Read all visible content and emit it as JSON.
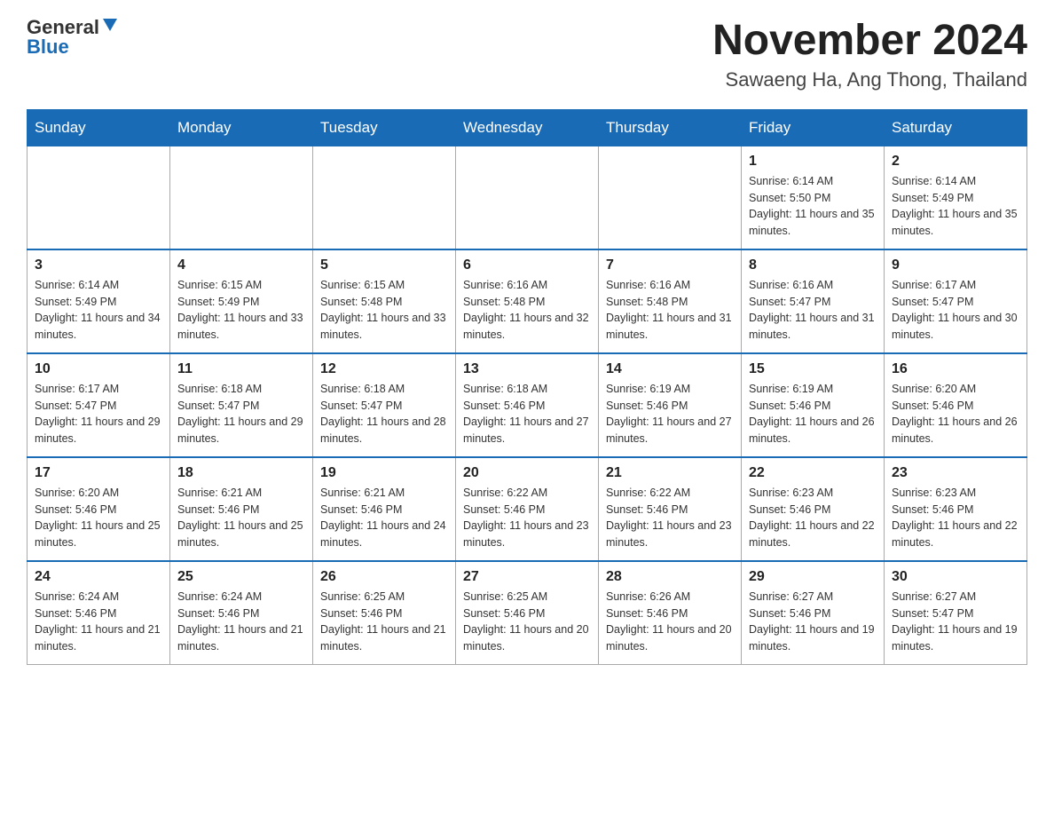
{
  "header": {
    "logo_general": "General",
    "logo_blue": "Blue",
    "month_title": "November 2024",
    "location": "Sawaeng Ha, Ang Thong, Thailand"
  },
  "days_of_week": [
    "Sunday",
    "Monday",
    "Tuesday",
    "Wednesday",
    "Thursday",
    "Friday",
    "Saturday"
  ],
  "weeks": [
    {
      "days": [
        {
          "num": "",
          "info": ""
        },
        {
          "num": "",
          "info": ""
        },
        {
          "num": "",
          "info": ""
        },
        {
          "num": "",
          "info": ""
        },
        {
          "num": "",
          "info": ""
        },
        {
          "num": "1",
          "info": "Sunrise: 6:14 AM\nSunset: 5:50 PM\nDaylight: 11 hours and 35 minutes."
        },
        {
          "num": "2",
          "info": "Sunrise: 6:14 AM\nSunset: 5:49 PM\nDaylight: 11 hours and 35 minutes."
        }
      ]
    },
    {
      "days": [
        {
          "num": "3",
          "info": "Sunrise: 6:14 AM\nSunset: 5:49 PM\nDaylight: 11 hours and 34 minutes."
        },
        {
          "num": "4",
          "info": "Sunrise: 6:15 AM\nSunset: 5:49 PM\nDaylight: 11 hours and 33 minutes."
        },
        {
          "num": "5",
          "info": "Sunrise: 6:15 AM\nSunset: 5:48 PM\nDaylight: 11 hours and 33 minutes."
        },
        {
          "num": "6",
          "info": "Sunrise: 6:16 AM\nSunset: 5:48 PM\nDaylight: 11 hours and 32 minutes."
        },
        {
          "num": "7",
          "info": "Sunrise: 6:16 AM\nSunset: 5:48 PM\nDaylight: 11 hours and 31 minutes."
        },
        {
          "num": "8",
          "info": "Sunrise: 6:16 AM\nSunset: 5:47 PM\nDaylight: 11 hours and 31 minutes."
        },
        {
          "num": "9",
          "info": "Sunrise: 6:17 AM\nSunset: 5:47 PM\nDaylight: 11 hours and 30 minutes."
        }
      ]
    },
    {
      "days": [
        {
          "num": "10",
          "info": "Sunrise: 6:17 AM\nSunset: 5:47 PM\nDaylight: 11 hours and 29 minutes."
        },
        {
          "num": "11",
          "info": "Sunrise: 6:18 AM\nSunset: 5:47 PM\nDaylight: 11 hours and 29 minutes."
        },
        {
          "num": "12",
          "info": "Sunrise: 6:18 AM\nSunset: 5:47 PM\nDaylight: 11 hours and 28 minutes."
        },
        {
          "num": "13",
          "info": "Sunrise: 6:18 AM\nSunset: 5:46 PM\nDaylight: 11 hours and 27 minutes."
        },
        {
          "num": "14",
          "info": "Sunrise: 6:19 AM\nSunset: 5:46 PM\nDaylight: 11 hours and 27 minutes."
        },
        {
          "num": "15",
          "info": "Sunrise: 6:19 AM\nSunset: 5:46 PM\nDaylight: 11 hours and 26 minutes."
        },
        {
          "num": "16",
          "info": "Sunrise: 6:20 AM\nSunset: 5:46 PM\nDaylight: 11 hours and 26 minutes."
        }
      ]
    },
    {
      "days": [
        {
          "num": "17",
          "info": "Sunrise: 6:20 AM\nSunset: 5:46 PM\nDaylight: 11 hours and 25 minutes."
        },
        {
          "num": "18",
          "info": "Sunrise: 6:21 AM\nSunset: 5:46 PM\nDaylight: 11 hours and 25 minutes."
        },
        {
          "num": "19",
          "info": "Sunrise: 6:21 AM\nSunset: 5:46 PM\nDaylight: 11 hours and 24 minutes."
        },
        {
          "num": "20",
          "info": "Sunrise: 6:22 AM\nSunset: 5:46 PM\nDaylight: 11 hours and 23 minutes."
        },
        {
          "num": "21",
          "info": "Sunrise: 6:22 AM\nSunset: 5:46 PM\nDaylight: 11 hours and 23 minutes."
        },
        {
          "num": "22",
          "info": "Sunrise: 6:23 AM\nSunset: 5:46 PM\nDaylight: 11 hours and 22 minutes."
        },
        {
          "num": "23",
          "info": "Sunrise: 6:23 AM\nSunset: 5:46 PM\nDaylight: 11 hours and 22 minutes."
        }
      ]
    },
    {
      "days": [
        {
          "num": "24",
          "info": "Sunrise: 6:24 AM\nSunset: 5:46 PM\nDaylight: 11 hours and 21 minutes."
        },
        {
          "num": "25",
          "info": "Sunrise: 6:24 AM\nSunset: 5:46 PM\nDaylight: 11 hours and 21 minutes."
        },
        {
          "num": "26",
          "info": "Sunrise: 6:25 AM\nSunset: 5:46 PM\nDaylight: 11 hours and 21 minutes."
        },
        {
          "num": "27",
          "info": "Sunrise: 6:25 AM\nSunset: 5:46 PM\nDaylight: 11 hours and 20 minutes."
        },
        {
          "num": "28",
          "info": "Sunrise: 6:26 AM\nSunset: 5:46 PM\nDaylight: 11 hours and 20 minutes."
        },
        {
          "num": "29",
          "info": "Sunrise: 6:27 AM\nSunset: 5:46 PM\nDaylight: 11 hours and 19 minutes."
        },
        {
          "num": "30",
          "info": "Sunrise: 6:27 AM\nSunset: 5:47 PM\nDaylight: 11 hours and 19 minutes."
        }
      ]
    }
  ]
}
